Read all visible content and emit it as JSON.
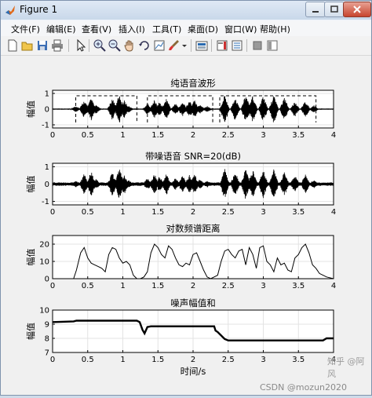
{
  "window": {
    "title": "Figure 1"
  },
  "menu": [
    "文件(F)",
    "编辑(E)",
    "查看(V)",
    "插入(I)",
    "工具(T)",
    "桌面(D)",
    "窗口(W)",
    "帮助(H)"
  ],
  "toolbar_icons": [
    "new-figure-icon",
    "open-file-icon",
    "save-icon",
    "print-icon",
    "pointer-icon",
    "zoom-in-icon",
    "zoom-out-icon",
    "pan-icon",
    "rotate-3d-icon",
    "data-cursor-icon",
    "brush-icon",
    "link-plot-icon",
    "colorbar-icon",
    "legend-icon",
    "hide-plot-tools-icon",
    "show-plot-tools-icon"
  ],
  "watermark": {
    "site": "知乎 @阿风",
    "csdn": "CSDN @mozun2020"
  },
  "chart_data": [
    {
      "type": "line",
      "title": "纯语音波形",
      "ylabel": "幅值",
      "xlim": [
        0,
        4
      ],
      "ylim": [
        -1.2,
        1.2
      ],
      "xticks": [
        "0",
        "0.5",
        "1",
        "1.5",
        "2",
        "2.5",
        "3",
        "3.5",
        "4"
      ],
      "yticks": [
        "-1",
        "0",
        "1"
      ],
      "envelope": [
        [
          0.33,
          0.2
        ],
        [
          0.45,
          0.6
        ],
        [
          0.55,
          0.75
        ],
        [
          0.62,
          0.3
        ],
        [
          0.85,
          0.7
        ],
        [
          0.95,
          0.95
        ],
        [
          1.02,
          0.6
        ],
        [
          1.08,
          0.25
        ],
        [
          1.35,
          0.35
        ],
        [
          1.45,
          0.6
        ],
        [
          1.52,
          0.45
        ],
        [
          1.62,
          0.65
        ],
        [
          1.75,
          0.35
        ],
        [
          1.85,
          0.5
        ],
        [
          1.95,
          0.55
        ],
        [
          2.02,
          0.6
        ],
        [
          2.1,
          0.3
        ],
        [
          2.2,
          0.2
        ],
        [
          2.45,
          0.95
        ],
        [
          2.6,
          0.75
        ],
        [
          2.75,
          0.95
        ],
        [
          2.85,
          0.85
        ],
        [
          3.0,
          0.85
        ],
        [
          3.15,
          0.95
        ],
        [
          3.3,
          0.75
        ],
        [
          3.45,
          0.5
        ],
        [
          3.6,
          0.55
        ],
        [
          3.72,
          0.25
        ]
      ],
      "segments": [
        [
          0.33,
          1.2
        ],
        [
          1.35,
          2.28
        ],
        [
          2.38,
          3.75
        ]
      ],
      "segment_level": 0.85
    },
    {
      "type": "line",
      "title": "带噪语音 SNR=20(dB)",
      "ylabel": "幅值",
      "xlim": [
        0,
        4
      ],
      "ylim": [
        -1.2,
        1.2
      ],
      "xticks": [
        "0",
        "0.5",
        "1",
        "1.5",
        "2",
        "2.5",
        "3",
        "3.5",
        "4"
      ],
      "yticks": [
        "-1",
        "0",
        "1"
      ],
      "noise_floor": 0.1
    },
    {
      "type": "line",
      "title": "对数频谱距离",
      "ylabel": "幅值",
      "xlim": [
        0,
        4
      ],
      "ylim": [
        0,
        25
      ],
      "xticks": [
        "0",
        "0.5",
        "1",
        "1.5",
        "2",
        "2.5",
        "3",
        "3.5",
        "4"
      ],
      "yticks": [
        "0",
        "10",
        "20"
      ],
      "x": [
        0,
        0.3,
        0.34,
        0.4,
        0.45,
        0.5,
        0.55,
        0.6,
        0.65,
        0.7,
        0.75,
        0.8,
        0.85,
        0.9,
        0.95,
        1.0,
        1.05,
        1.1,
        1.15,
        1.2,
        1.25,
        1.3,
        1.35,
        1.4,
        1.45,
        1.5,
        1.55,
        1.6,
        1.65,
        1.7,
        1.75,
        1.8,
        1.85,
        1.9,
        1.95,
        2.0,
        2.05,
        2.1,
        2.15,
        2.2,
        2.25,
        2.3,
        2.35,
        2.4,
        2.45,
        2.5,
        2.55,
        2.6,
        2.65,
        2.7,
        2.75,
        2.8,
        2.85,
        2.9,
        2.95,
        3.0,
        3.05,
        3.1,
        3.15,
        3.2,
        3.25,
        3.3,
        3.35,
        3.4,
        3.45,
        3.5,
        3.55,
        3.6,
        3.65,
        3.7,
        3.75,
        3.8,
        3.85,
        3.9,
        4.0
      ],
      "y": [
        0,
        0,
        5,
        15,
        18,
        12,
        9,
        8,
        7,
        6,
        4,
        14,
        18,
        17,
        12,
        9,
        10,
        8,
        2,
        0,
        0,
        1,
        4,
        15,
        20,
        18,
        14,
        12,
        19,
        17,
        12,
        8,
        7,
        9,
        8,
        14,
        15,
        10,
        5,
        1,
        0,
        1,
        2,
        10,
        16,
        17,
        14,
        12,
        16,
        17,
        8,
        18,
        14,
        6,
        18,
        19,
        10,
        8,
        4,
        12,
        8,
        9,
        5,
        4,
        12,
        14,
        18,
        20,
        15,
        8,
        6,
        3,
        2,
        1,
        0
      ]
    },
    {
      "type": "line",
      "title": "噪声幅值和",
      "ylabel": "幅值",
      "xlabel": "时间/s",
      "xlim": [
        0,
        4
      ],
      "ylim": [
        7,
        10
      ],
      "xticks": [
        "0",
        "0.5",
        "1",
        "1.5",
        "2",
        "2.5",
        "3",
        "3.5",
        "4"
      ],
      "yticks": [
        "7",
        "8",
        "9",
        "10"
      ],
      "x": [
        0,
        0.3,
        0.34,
        1.2,
        1.24,
        1.28,
        1.31,
        1.35,
        1.4,
        2.3,
        2.32,
        2.35,
        2.45,
        2.5,
        3.85,
        3.9,
        4.0
      ],
      "y": [
        9.15,
        9.2,
        9.25,
        9.25,
        9.15,
        8.6,
        8.35,
        8.8,
        8.85,
        8.85,
        8.55,
        8.45,
        7.95,
        7.85,
        7.85,
        8.0,
        8.0
      ]
    }
  ]
}
